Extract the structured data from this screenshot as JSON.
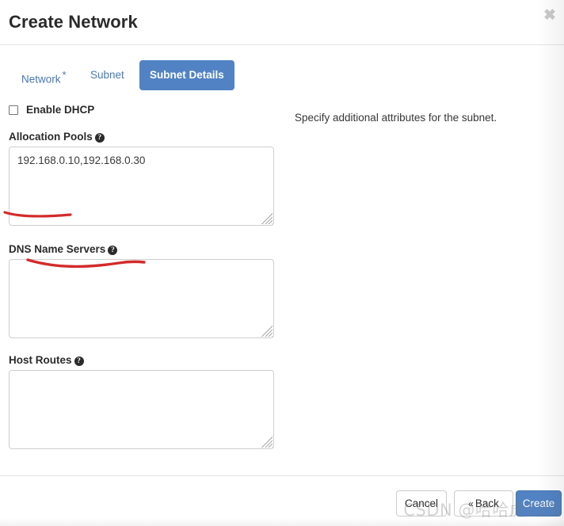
{
  "header": {
    "title": "Create Network",
    "close_label": "✖"
  },
  "tabs": [
    {
      "label": "Network",
      "required_marker": "*",
      "active": false
    },
    {
      "label": "Subnet",
      "required_marker": "",
      "active": false
    },
    {
      "label": "Subnet Details",
      "required_marker": "",
      "active": true
    }
  ],
  "form": {
    "enable_dhcp": {
      "label": "Enable DHCP",
      "checked": false
    },
    "allocation_pools": {
      "label": "Allocation Pools",
      "help": "?",
      "value": "192.168.0.10,192.168.0.30",
      "placeholder": ""
    },
    "dns_name_servers": {
      "label": "DNS Name Servers",
      "help": "?",
      "value": "",
      "placeholder": ""
    },
    "host_routes": {
      "label": "Host Routes",
      "help": "?",
      "value": "",
      "placeholder": ""
    }
  },
  "help_panel": {
    "text": "Specify additional attributes for the subnet."
  },
  "footer": {
    "cancel_label": "Cancel",
    "back_chevron": "«",
    "back_label": "Back",
    "create_label": "Create"
  },
  "watermark": {
    "text": "CSDN @哈哈虎123"
  },
  "colors": {
    "accent_blue": "#5183c4",
    "link_blue": "#4679b5",
    "annotation_red": "#d32b2b",
    "border_gray": "#cfcfcf",
    "text_dark": "#2b2b2b"
  }
}
